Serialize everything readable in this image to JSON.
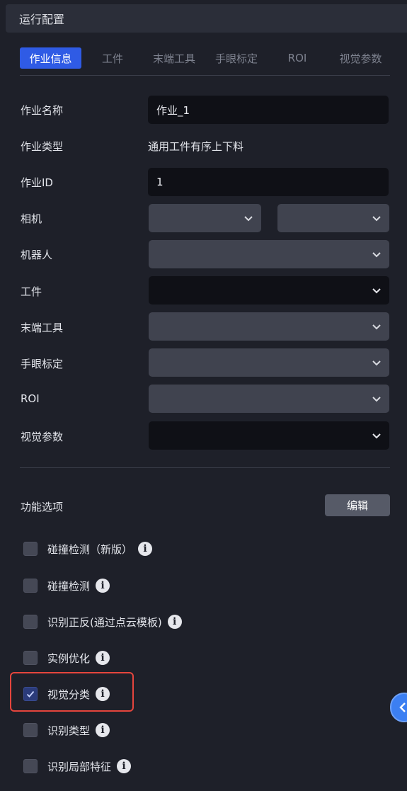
{
  "window": {
    "title": "运行配置"
  },
  "tabs": [
    {
      "label": "作业信息",
      "active": true
    },
    {
      "label": "工件",
      "active": false
    },
    {
      "label": "末端工具",
      "active": false
    },
    {
      "label": "手眼标定",
      "active": false
    },
    {
      "label": "ROI",
      "active": false
    },
    {
      "label": "视觉参数",
      "active": false
    }
  ],
  "form": {
    "job_name": {
      "label": "作业名称",
      "value": "作业_1"
    },
    "job_type": {
      "label": "作业类型",
      "value": "通用工件有序上下料"
    },
    "job_id": {
      "label": "作业ID",
      "value": "1"
    },
    "camera": {
      "label": "相机",
      "value_1": "",
      "value_2": ""
    },
    "robot": {
      "label": "机器人",
      "value": ""
    },
    "workpiece": {
      "label": "工件",
      "value": ""
    },
    "end_tool": {
      "label": "末端工具",
      "value": ""
    },
    "hand_eye": {
      "label": "手眼标定",
      "value": ""
    },
    "roi": {
      "label": "ROI",
      "value": ""
    },
    "vision_params": {
      "label": "视觉参数",
      "value": ""
    }
  },
  "features": {
    "title": "功能选项",
    "edit_label": "编辑",
    "options": [
      {
        "label": "碰撞检测（新版）",
        "checked": false
      },
      {
        "label": "碰撞检测",
        "checked": false
      },
      {
        "label": "识别正反(通过点云模板)",
        "checked": false
      },
      {
        "label": "实例优化",
        "checked": false
      },
      {
        "label": "视觉分类",
        "checked": true
      },
      {
        "label": "识别类型",
        "checked": false
      },
      {
        "label": "识别局部特征",
        "checked": false
      }
    ],
    "info_glyph": "i"
  },
  "colors": {
    "accent": "#2f5be5",
    "highlight_border": "#e5453d",
    "background": "#1e2029"
  },
  "icons": {
    "dropdown": "chevron-down-icon",
    "info": "info-icon",
    "checkbox_check": "check-icon",
    "collapse": "chevron-left-icon"
  }
}
